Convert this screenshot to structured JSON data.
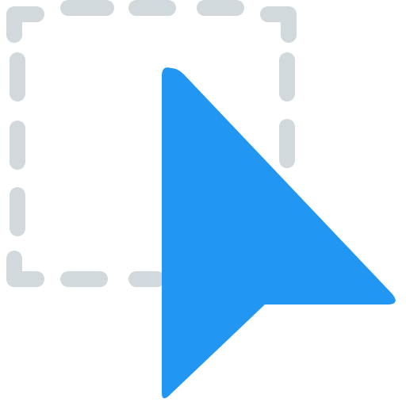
{
  "icon": {
    "name": "select-cursor-icon",
    "colors": {
      "selection_dash": "#d1d9dd",
      "cursor_fill": "#2196f3",
      "background": "#ffffff"
    }
  }
}
